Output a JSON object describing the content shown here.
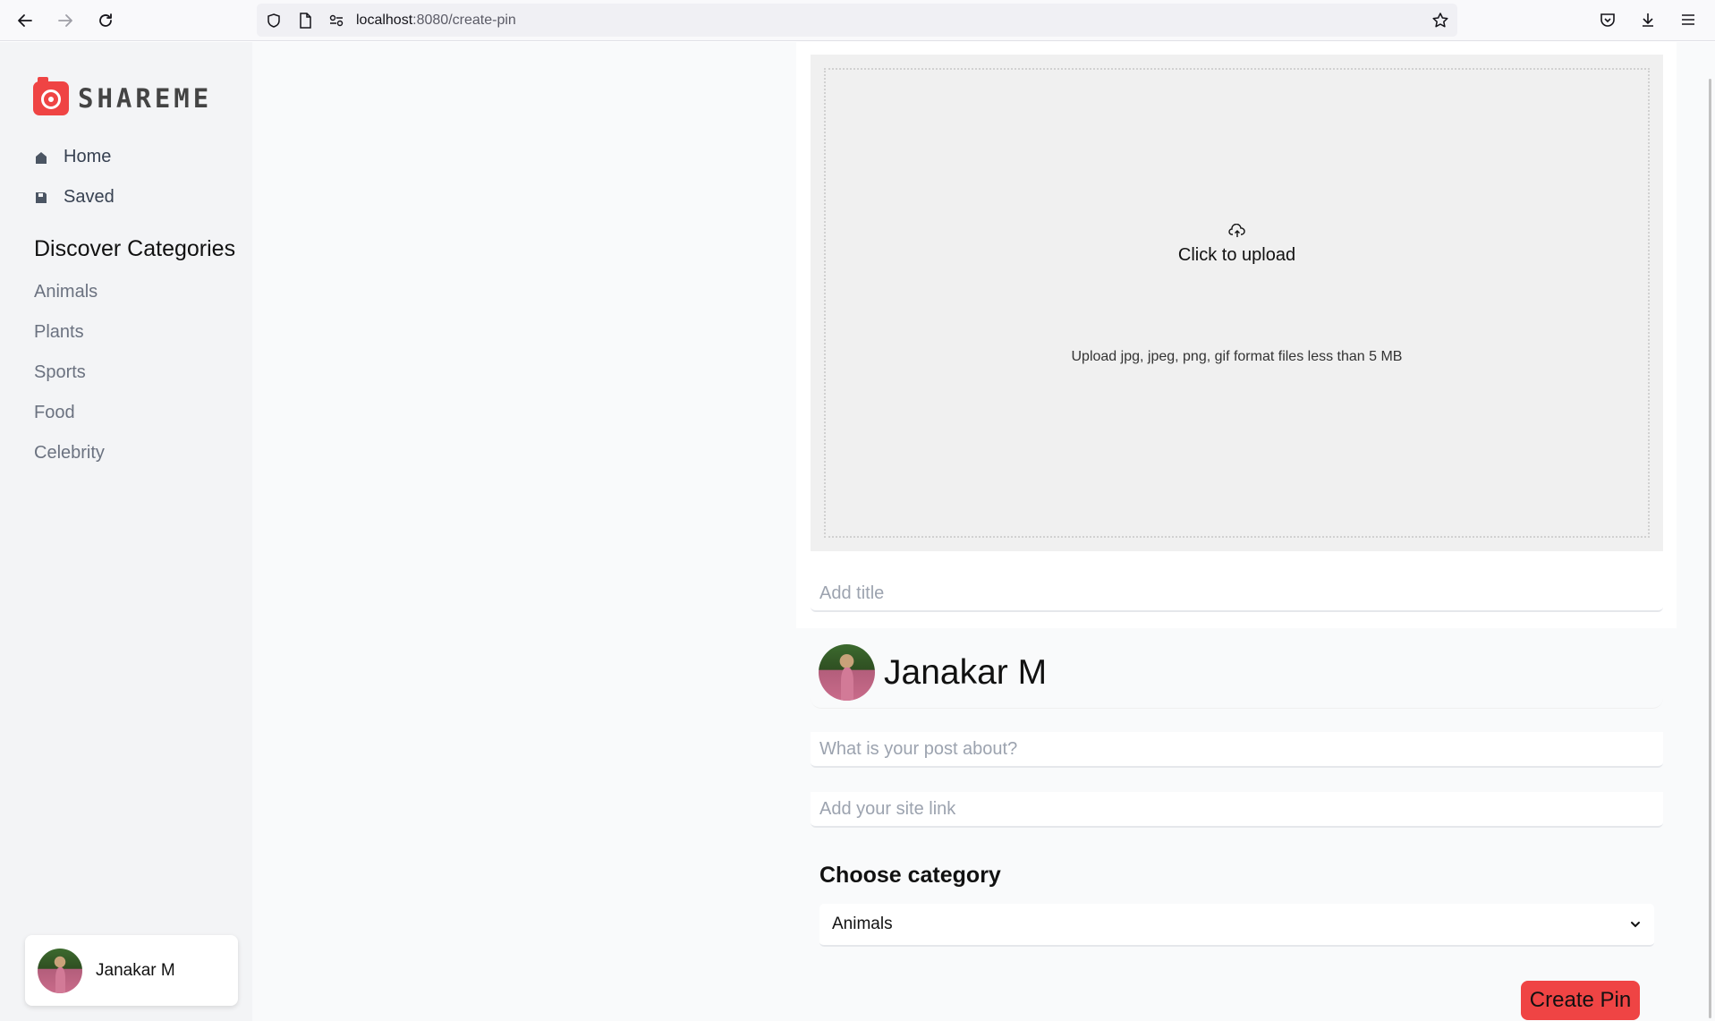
{
  "browser": {
    "url_host": "localhost",
    "url_path": ":8080/create-pin"
  },
  "sidebar": {
    "logo_text": "SHAREME",
    "menu": [
      {
        "label": "Home",
        "icon": "home-icon"
      },
      {
        "label": "Saved",
        "icon": "save-icon"
      }
    ],
    "categories_heading": "Discover Categories",
    "categories": [
      "Animals",
      "Plants",
      "Sports",
      "Food",
      "Celebrity"
    ],
    "user_name": "Janakar M"
  },
  "upload": {
    "title": "Click to upload",
    "hint": "Upload jpg, jpeg, png, gif format files less than 5 MB"
  },
  "form": {
    "title_placeholder": "Add title",
    "author_name": "Janakar M",
    "about_placeholder": "What is your post about?",
    "link_placeholder": "Add your site link",
    "category_label": "Choose category",
    "category_selected": "Animals",
    "submit_label": "Create Pin"
  },
  "colors": {
    "accent": "#ef4444"
  }
}
